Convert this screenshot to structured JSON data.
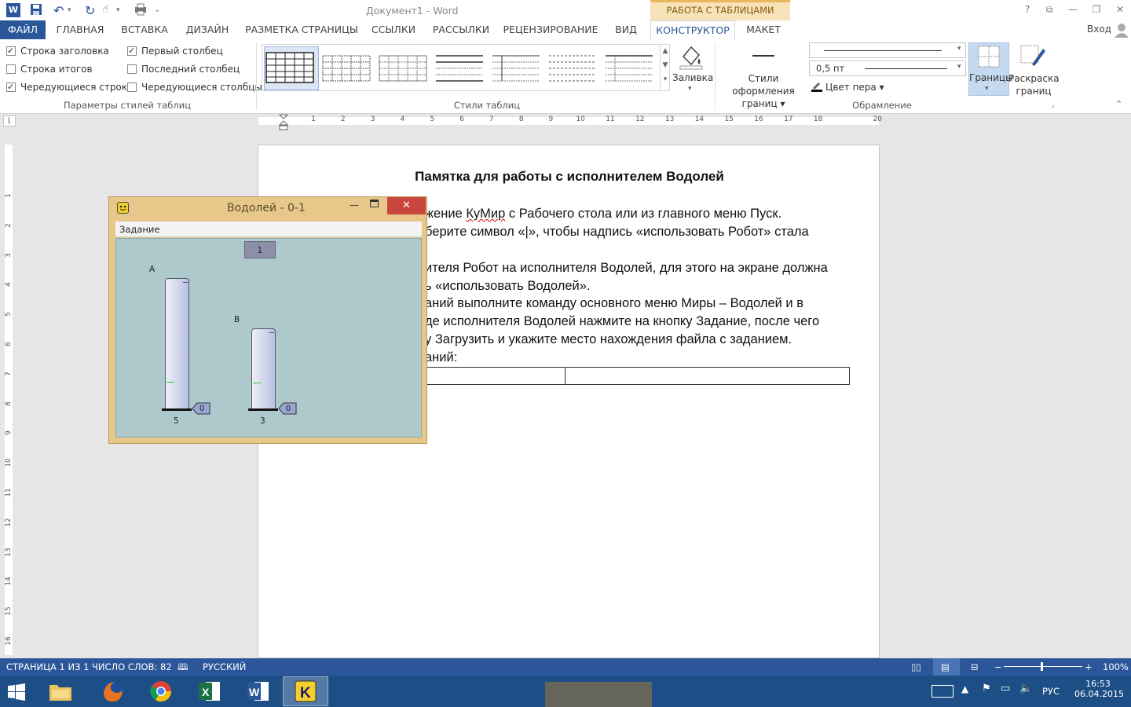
{
  "window": {
    "title": "Документ1 - Word",
    "context_title": "РАБОТА С ТАБЛИЦАМИ",
    "login": "Вход"
  },
  "tabs": [
    {
      "label": "ФАЙЛ"
    },
    {
      "label": "ГЛАВНАЯ"
    },
    {
      "label": "ВСТАВКА"
    },
    {
      "label": "ДИЗАЙН"
    },
    {
      "label": "РАЗМЕТКА СТРАНИЦЫ"
    },
    {
      "label": "ССЫЛКИ"
    },
    {
      "label": "РАССЫЛКИ"
    },
    {
      "label": "РЕЦЕНЗИРОВАНИЕ"
    },
    {
      "label": "ВИД"
    },
    {
      "label": "КОНСТРУКТОР"
    },
    {
      "label": "МАКЕТ"
    }
  ],
  "style_options": {
    "header_row": "Строка заголовка",
    "total_row": "Строка итогов",
    "banded_rows": "Чередующиеся строки",
    "first_column": "Первый столбец",
    "last_column": "Последний столбец",
    "banded_columns": "Чередующиеся столбцы",
    "group_label": "Параметры стилей таблиц"
  },
  "table_styles": {
    "group_label": "Стили таблиц"
  },
  "borders": {
    "shading": "Заливка",
    "border_styles_1": "Стили оформления",
    "border_styles_2": "границ",
    "pen_weight": "0,5 пт",
    "pen_color": "Цвет пера",
    "borders_btn": "Границы",
    "painter_1": "Раскраска",
    "painter_2": "границ",
    "group_label": "Обрамление"
  },
  "ruler": {
    "h": [
      "1",
      "2",
      "3",
      "4",
      "5",
      "6",
      "7",
      "8",
      "9",
      "10",
      "11",
      "12",
      "13",
      "14",
      "15",
      "16",
      "17",
      "18",
      "20"
    ],
    "v": [
      "1",
      "2",
      "3",
      "4",
      "5",
      "6",
      "7",
      "8",
      "9",
      "10",
      "11",
      "12",
      "13",
      "14",
      "15",
      "16"
    ]
  },
  "document": {
    "title": "Памятка для работы с исполнителем Водолей",
    "lines": [
      "жение ",
      " с Рабочего стола или из главного меню Пуск.",
      "берите символ «|», чтобы надпись «использовать Робот» стала",
      "ителя Робот на исполнителя Водолей, для этого на экране должна",
      "ь «использовать Водолей».",
      "аний выполните команду основного меню Миры – Водолей и в",
      "де исполнителя Водолей нажмите на кнопку Задание, после чего",
      "у Загрузить и укажите место нахождения файла с заданием.",
      "аний:"
    ],
    "kumir": "КуМир"
  },
  "vodoley": {
    "title": "Водолей - 0-1",
    "menu": "Задание",
    "goal": "1",
    "vessel_a": {
      "name": "A",
      "capacity": "5",
      "amount": "0"
    },
    "vessel_b": {
      "name": "B",
      "capacity": "3",
      "amount": "0"
    }
  },
  "status": {
    "page": "СТРАНИЦА 1 ИЗ 1",
    "words": "ЧИСЛО СЛОВ: 82",
    "language": "РУССКИЙ",
    "zoom": "100%"
  },
  "tray": {
    "lang": "РУС",
    "time": "16:53",
    "date": "06.04.2015"
  },
  "colors": {
    "accent": "#2b579a",
    "vodoley_frame": "#e8c88a",
    "vodoley_canvas": "#adc9cb"
  }
}
